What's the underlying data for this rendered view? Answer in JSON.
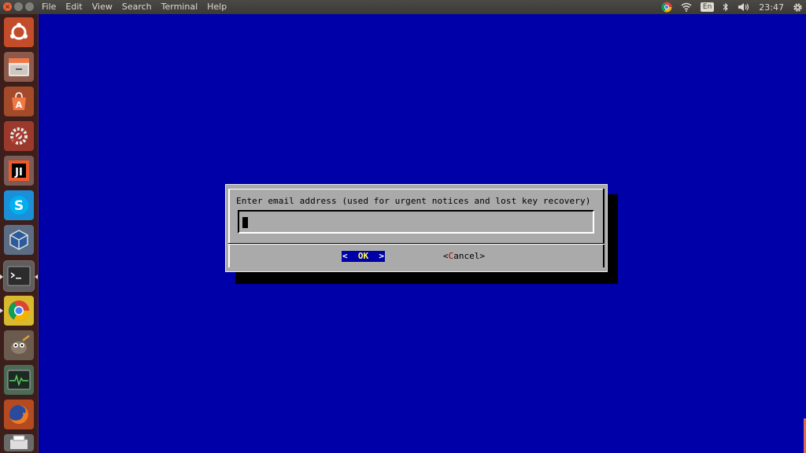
{
  "topbar": {
    "menu": [
      "File",
      "Edit",
      "View",
      "Search",
      "Terminal",
      "Help"
    ],
    "keyboard_layout": "En",
    "clock": "23:47"
  },
  "launcher": {
    "items": [
      "ubuntu-icon",
      "files-icon",
      "software-center-icon",
      "settings-icon",
      "jetbrains-icon",
      "skype-icon",
      "virtualbox-icon",
      "terminal-icon",
      "chrome-icon",
      "gimp-icon",
      "system-monitor-icon",
      "firefox-icon",
      "printer-icon"
    ]
  },
  "dialog": {
    "prompt": "Enter email address (used for urgent notices and lost key recovery)",
    "input_value": "",
    "ok_left": "<",
    "ok_label": "OK",
    "ok_right": ">",
    "cancel_left": "<",
    "cancel_hot": "C",
    "cancel_rest": "ancel",
    "cancel_right": ">"
  },
  "colors": {
    "terminal_bg": "#0000a8",
    "dialog_bg": "#aaaaaa",
    "launcher_bg": "#3c1f1a"
  }
}
